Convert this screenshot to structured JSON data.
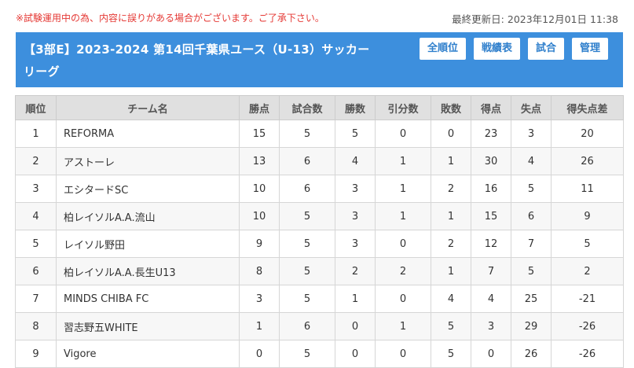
{
  "notice": "※試験運用中の為、内容に誤りがある場合がございます。ご了承下さい。",
  "updated": {
    "label": "最終更新日:",
    "value": "2023年12月01日 11:38"
  },
  "header": {
    "title_line1": "【3部E】2023-2024 第14回千葉県ユース（U-13）サッカー",
    "title_line2": "リーグ",
    "buttons": [
      "全順位",
      "戦績表",
      "試合",
      "管理"
    ]
  },
  "table": {
    "columns": [
      "順位",
      "チーム名",
      "勝点",
      "試合数",
      "勝数",
      "引分数",
      "敗数",
      "得点",
      "失点",
      "得失点差"
    ],
    "rows": [
      [
        "1",
        "REFORMA",
        "15",
        "5",
        "5",
        "0",
        "0",
        "23",
        "3",
        "20"
      ],
      [
        "2",
        "アストーレ",
        "13",
        "6",
        "4",
        "1",
        "1",
        "30",
        "4",
        "26"
      ],
      [
        "3",
        "エシタードSC",
        "10",
        "6",
        "3",
        "1",
        "2",
        "16",
        "5",
        "11"
      ],
      [
        "4",
        "柏レイソルA.A.流山",
        "10",
        "5",
        "3",
        "1",
        "1",
        "15",
        "6",
        "9"
      ],
      [
        "5",
        "レイソル野田",
        "9",
        "5",
        "3",
        "0",
        "2",
        "12",
        "7",
        "5"
      ],
      [
        "6",
        "柏レイソルA.A.長生U13",
        "8",
        "5",
        "2",
        "2",
        "1",
        "7",
        "5",
        "2"
      ],
      [
        "7",
        "MINDS CHIBA FC",
        "3",
        "5",
        "1",
        "0",
        "4",
        "4",
        "25",
        "-21"
      ],
      [
        "8",
        "習志野五WHITE",
        "1",
        "6",
        "0",
        "1",
        "5",
        "3",
        "29",
        "-26"
      ],
      [
        "9",
        "Vigore",
        "0",
        "5",
        "0",
        "0",
        "5",
        "0",
        "26",
        "-26"
      ]
    ]
  },
  "colors": {
    "header_bg": "#3d8fdd",
    "notice": "#e53935",
    "button_text": "#2f7fcc"
  }
}
